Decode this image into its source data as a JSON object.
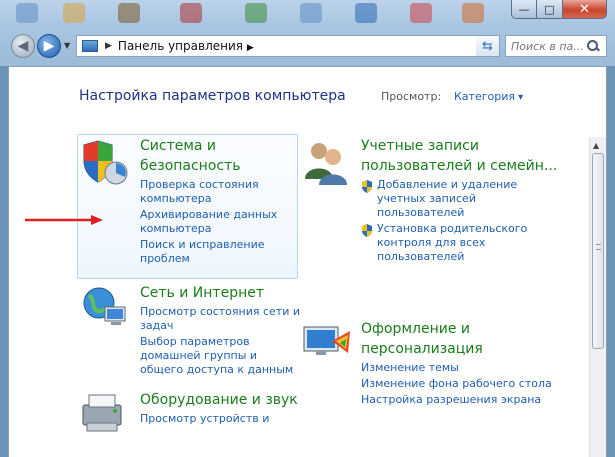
{
  "window": {
    "close_glyph": "✕",
    "maximize_glyph": "□",
    "minimize_glyph": "—"
  },
  "address_bar": {
    "path": "Панель управления",
    "separator": "▶",
    "trailing": "▶"
  },
  "search": {
    "placeholder": "Поиск в па..."
  },
  "header": {
    "title": "Настройка параметров компьютера",
    "view_label": "Просмотр:",
    "view_value": "Категория"
  },
  "categories": [
    {
      "title": "Система и безопасность",
      "links": [
        "Проверка состояния компьютера",
        "Архивирование данных компьютера",
        "Поиск и исправление проблем"
      ]
    },
    {
      "title": "Учетные записи пользователей и семейн...",
      "links": [
        "Добавление и удаление учетных записей пользователей",
        "Установка родительского контроля для всех пользователей"
      ]
    },
    {
      "title": "Сеть и Интернет",
      "links": [
        "Просмотр состояния сети и задач",
        "Выбор параметров домашней группы и общего доступа к данным"
      ]
    },
    {
      "title": "Оформление и персонализация",
      "links": [
        "Изменение темы",
        "Изменение фона рабочего стола",
        "Настройка разрешения экрана"
      ]
    },
    {
      "title": "Оборудование и звук",
      "links": [
        "Просмотр устройств и"
      ]
    }
  ],
  "colors": {
    "category_title": "#1c7d1c",
    "link": "#1f5fae",
    "page_title": "#1e3287",
    "annotation_arrow": "#e02020"
  }
}
